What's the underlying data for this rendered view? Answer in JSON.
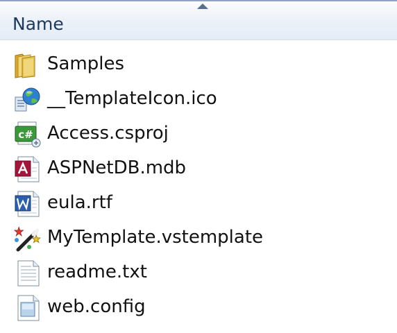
{
  "header": {
    "column_name": "Name",
    "sort_direction": "ascending"
  },
  "files": [
    {
      "name": "Samples",
      "icon": "folder-icon",
      "type": "folder"
    },
    {
      "name": "__TemplateIcon.ico",
      "icon": "ico-file-icon",
      "type": "icon"
    },
    {
      "name": "Access.csproj",
      "icon": "csharp-project-icon",
      "type": "csproj"
    },
    {
      "name": "ASPNetDB.mdb",
      "icon": "access-database-icon",
      "type": "mdb"
    },
    {
      "name": "eula.rtf",
      "icon": "word-document-icon",
      "type": "rtf"
    },
    {
      "name": "MyTemplate.vstemplate",
      "icon": "vstemplate-icon",
      "type": "vstemplate"
    },
    {
      "name": "readme.txt",
      "icon": "text-document-icon",
      "type": "txt"
    },
    {
      "name": "web.config",
      "icon": "config-file-icon",
      "type": "config"
    }
  ],
  "colors": {
    "header_border": "#8da3c1",
    "header_text": "#1e395b",
    "file_text": "#111111",
    "folder_yellow": "#e8c34a"
  }
}
